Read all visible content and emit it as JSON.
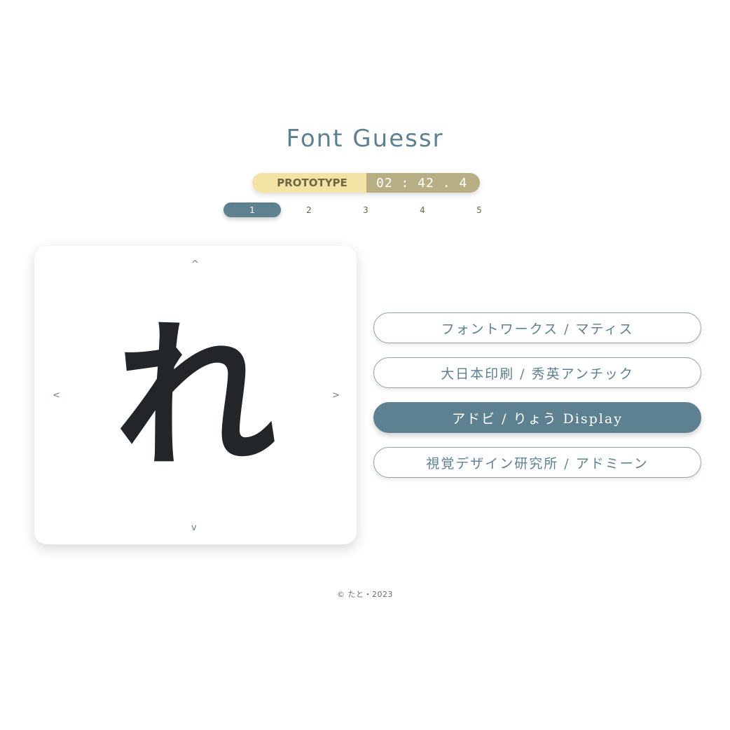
{
  "app": {
    "title": "Font Guessr"
  },
  "status": {
    "mode": "PROTOTYPE",
    "timer": "02 : 42 . 4"
  },
  "rounds": {
    "items": [
      "1",
      "2",
      "3",
      "4",
      "5"
    ],
    "active": "1"
  },
  "card": {
    "glyph": "れ",
    "nav_up": "^",
    "nav_down": "v",
    "nav_left": "<",
    "nav_right": ">"
  },
  "options": [
    {
      "label": "フォントワークス / マティス",
      "selected": false
    },
    {
      "label": "大日本印刷 / 秀英アンチック",
      "selected": false
    },
    {
      "label": "アドビ / りょう Display",
      "selected": true
    },
    {
      "label": "視覚デザイン研究所 / アドミーン",
      "selected": false
    }
  ],
  "footer": {
    "text": "© たと・2023"
  },
  "colors": {
    "accent": "#5d8191",
    "mode_bg": "#f3e4a6",
    "timer_bg": "#b8ae84",
    "glyph": "#232629"
  }
}
